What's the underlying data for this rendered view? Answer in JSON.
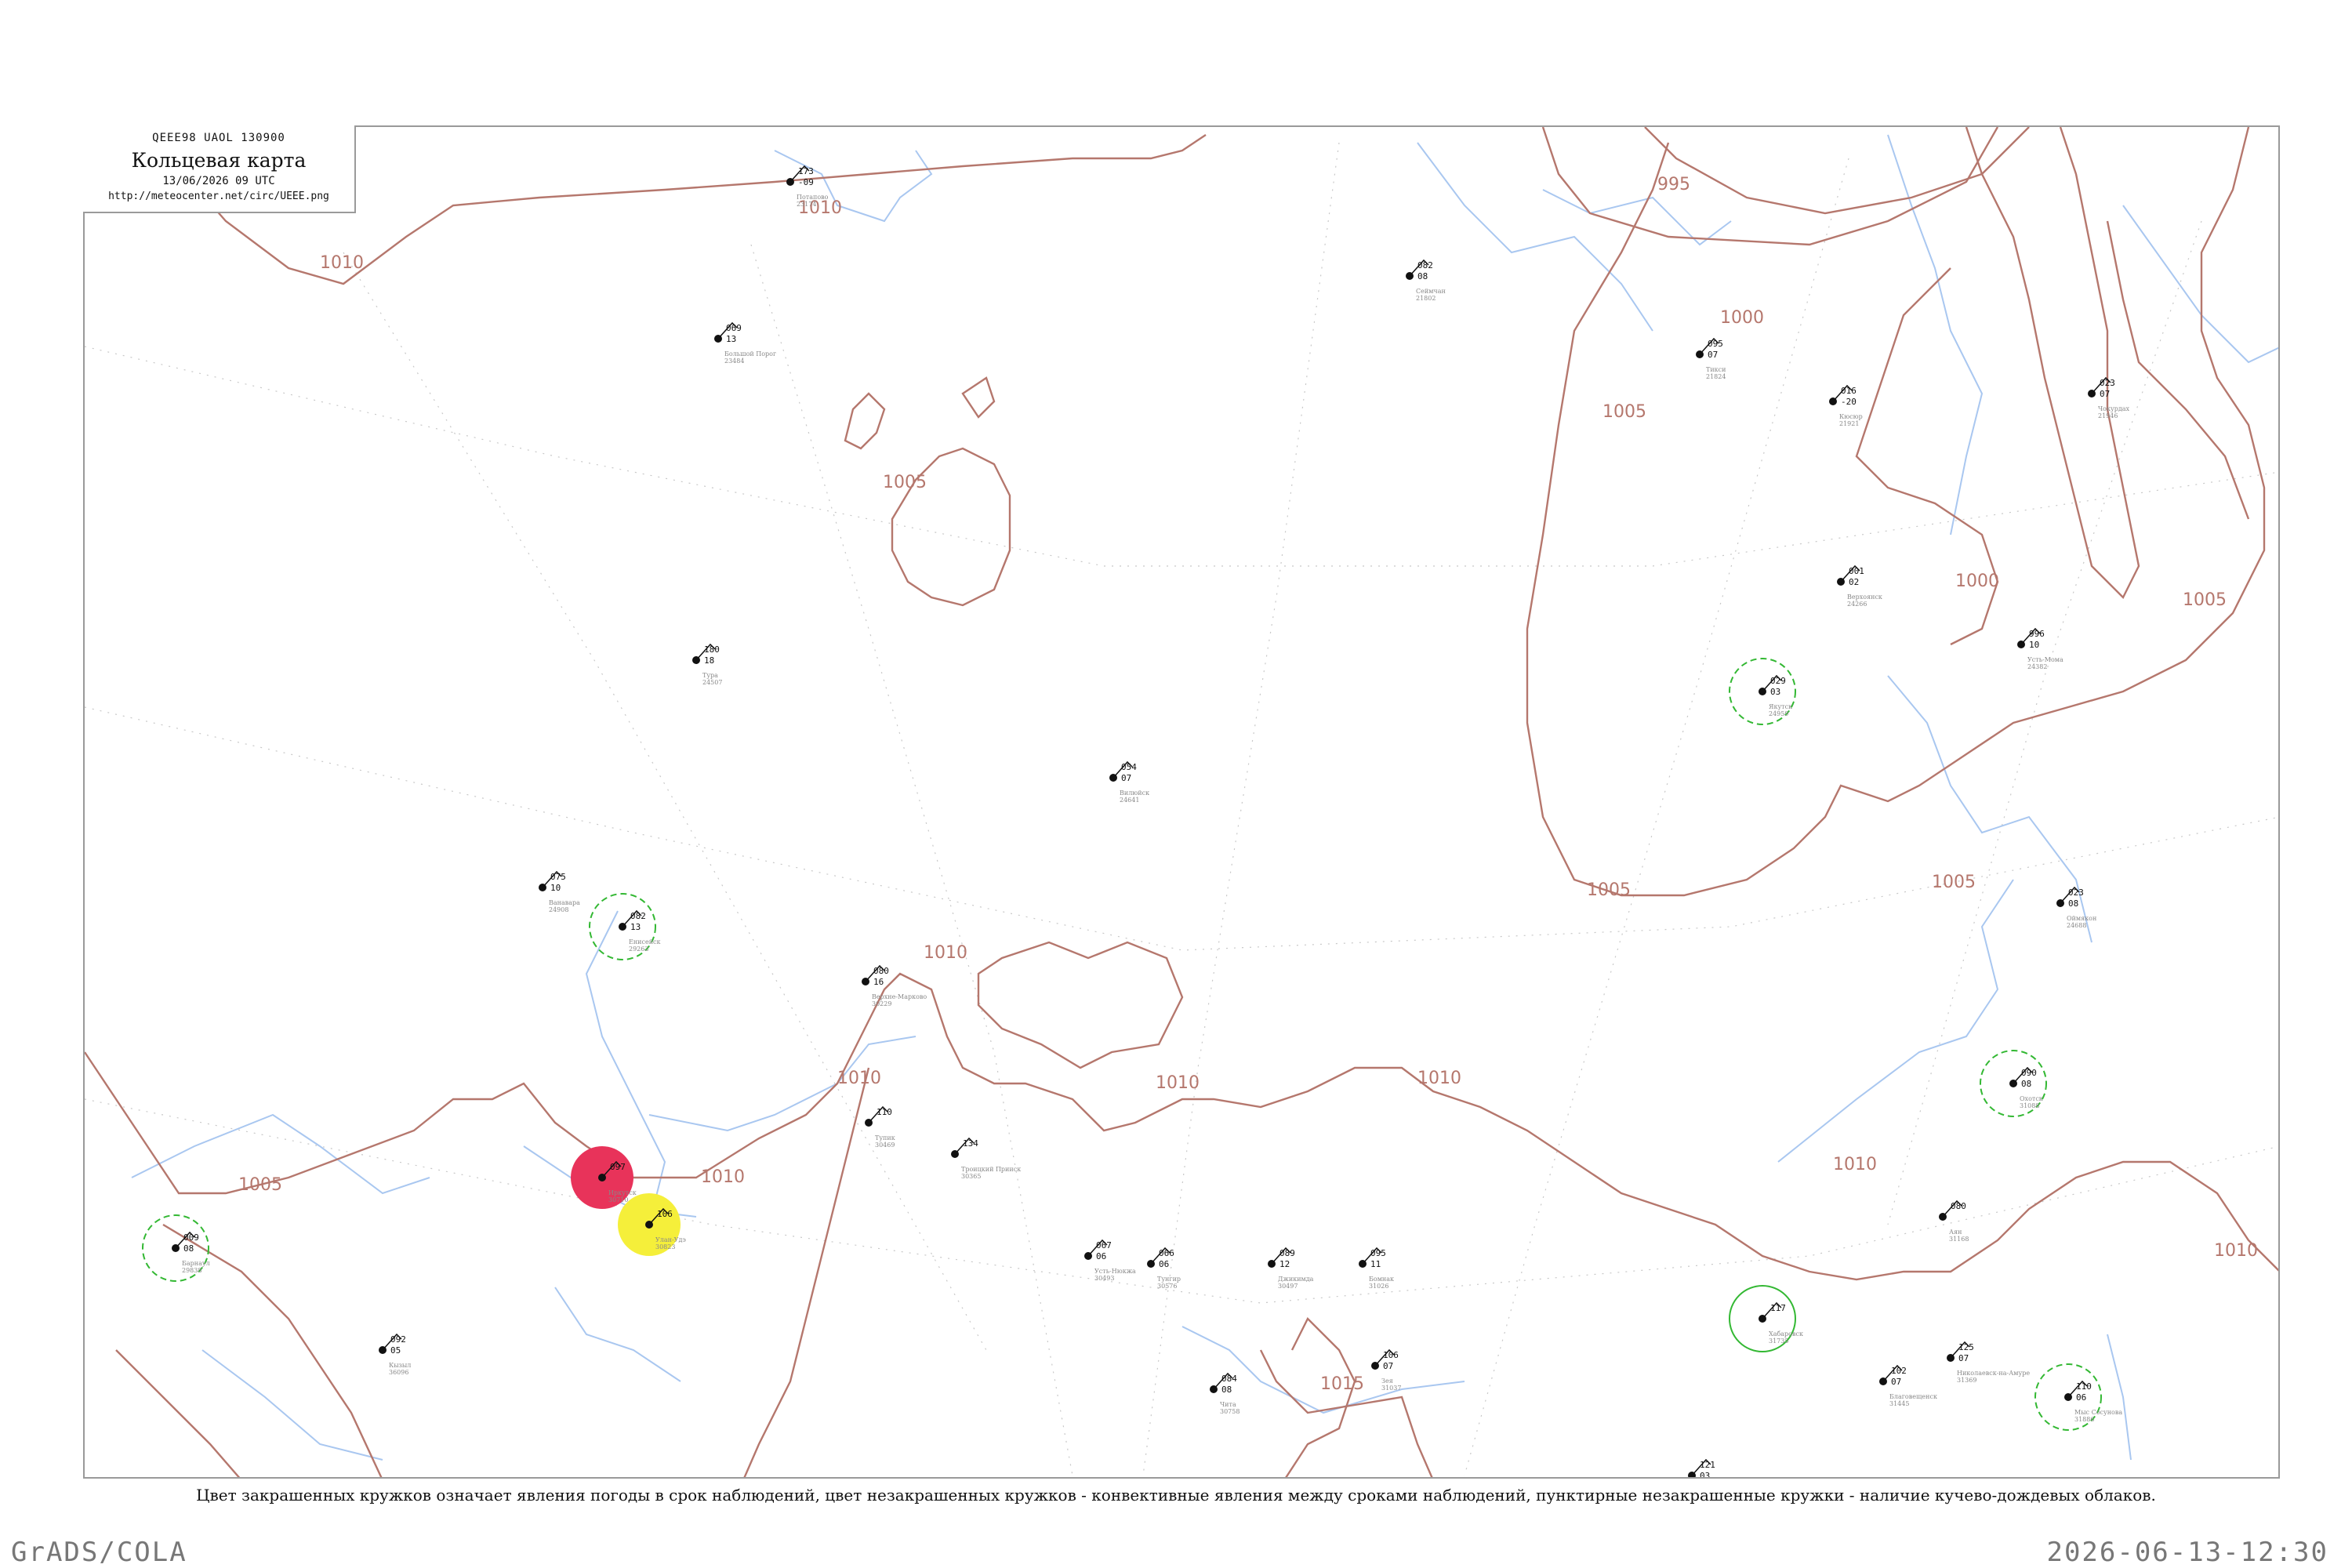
{
  "header": {
    "code": "QEEE98 UAOL 130900",
    "title": "Кольцевая карта",
    "datetime": "13/06/2026 09 UTC",
    "url": "http://meteocenter.net/circ/UEEE.png"
  },
  "caption": "Цвет закрашенных кружков означает явления погоды в срок наблюдений, цвет незакрашенных кружков - конвективные явления между сроками наблюдений, пунктирные незакрашенные кружки - наличие кучево-дождевых облаков.",
  "footer": {
    "left": "GrADS/COLA",
    "right": "2026-06-13-12:30"
  },
  "colors": {
    "isobar": "#b5776d",
    "coast": "#a9c7f0",
    "frame": "#9a9a9a",
    "cb_dashed": "#33b833",
    "fill_red": "#e8335a",
    "fill_green": "#1fb83a",
    "fill_yellow": "#f5ef3a"
  },
  "isobar_labels": [
    "1010",
    "1010",
    "1005",
    "995",
    "1000",
    "1005",
    "1000",
    "1005",
    "1005",
    "1005",
    "1010",
    "1010",
    "1010",
    "1010",
    "1010",
    "1005",
    "1010",
    "1015",
    "1010"
  ],
  "stations": [
    {
      "name": "Потапово",
      "id": "23174",
      "p": "173",
      "t": "-09",
      "marker": "none"
    },
    {
      "name": "Большой Порог",
      "id": "23484",
      "p": "069",
      "t": "13",
      "marker": "none"
    },
    {
      "name": "Сеймчан",
      "id": "21802",
      "p": "082",
      "t": "08",
      "marker": "none"
    },
    {
      "name": "Тикси",
      "id": "21824",
      "p": "095",
      "t": "07",
      "marker": "none"
    },
    {
      "name": "Кюсюр",
      "id": "21921",
      "p": "016",
      "t": "-20",
      "marker": "none"
    },
    {
      "name": "Чокурдах",
      "id": "21946",
      "p": "023",
      "t": "07",
      "marker": "none"
    },
    {
      "name": "Верхоянск",
      "id": "24266",
      "p": "001",
      "t": "02",
      "marker": "none"
    },
    {
      "name": "Усть-Мома",
      "id": "24382",
      "p": "996",
      "t": "10",
      "marker": "none"
    },
    {
      "name": "Тура",
      "id": "24507",
      "p": "180",
      "t": "18",
      "marker": "none"
    },
    {
      "name": "Вилюйск",
      "id": "24641",
      "p": "054",
      "t": "07",
      "marker": "none"
    },
    {
      "name": "Ванавара",
      "id": "24908",
      "p": "075",
      "t": "10",
      "marker": "none"
    },
    {
      "name": "Енисейск",
      "id": "29263",
      "p": "082",
      "t": "13",
      "marker": "green-dashed"
    },
    {
      "name": "Верхне-Марково",
      "id": "30229",
      "p": "080",
      "t": "16",
      "marker": "none"
    },
    {
      "name": "Тупик",
      "id": "30469",
      "p": "110",
      "t": "",
      "marker": "none"
    },
    {
      "name": "Троицкий Прииск",
      "id": "30365",
      "p": "134",
      "t": "",
      "marker": "none"
    },
    {
      "name": "Усть-Нюкжа",
      "id": "30493",
      "p": "067",
      "t": "06",
      "marker": "none"
    },
    {
      "name": "Тунгир",
      "id": "30576",
      "p": "066",
      "t": "06",
      "marker": "none"
    },
    {
      "name": "Джикимда",
      "id": "30497",
      "p": "089",
      "t": "12",
      "marker": "none"
    },
    {
      "name": "Бомнак",
      "id": "31026",
      "p": "095",
      "t": "11",
      "marker": "none"
    },
    {
      "name": "Зея",
      "id": "31037",
      "p": "106",
      "t": "07",
      "marker": "none"
    },
    {
      "name": "Благовещенск",
      "id": "31445",
      "p": "102",
      "t": "07",
      "marker": "none"
    },
    {
      "name": "Чита",
      "id": "30758",
      "p": "084",
      "t": "08",
      "marker": "none"
    },
    {
      "name": "Магдагачи",
      "id": "31299",
      "p": "121",
      "t": "03",
      "marker": "none"
    },
    {
      "name": "Охотск",
      "id": "31088",
      "p": "090",
      "t": "08",
      "marker": "green-dashed"
    },
    {
      "name": "Аян",
      "id": "31168",
      "p": "080",
      "t": "",
      "marker": "none"
    },
    {
      "name": "Николаевск-на-Амуре",
      "id": "31369",
      "p": "125",
      "t": "07",
      "marker": "none"
    },
    {
      "name": "Хабаровск",
      "id": "31735",
      "p": "117",
      "t": "",
      "marker": "green-double"
    },
    {
      "name": "Мыс Сосунова",
      "id": "31886",
      "p": "110",
      "t": "06",
      "marker": "green-dashed"
    },
    {
      "name": "Оймякон",
      "id": "24688",
      "p": "023",
      "t": "08",
      "marker": "none"
    },
    {
      "name": "Якутск",
      "id": "24959",
      "p": "029",
      "t": "03",
      "marker": "green-dashed"
    },
    {
      "name": "Иркутск",
      "id": "30710",
      "p": "097",
      "t": "",
      "marker": "red-fill"
    },
    {
      "name": "Улан-Удэ",
      "id": "30823",
      "p": "106",
      "t": "",
      "marker": "yellow-fill"
    },
    {
      "name": "Кызыл",
      "id": "36096",
      "p": "092",
      "t": "05",
      "marker": "none"
    },
    {
      "name": "Барнаул",
      "id": "29838",
      "p": "009",
      "t": "08",
      "marker": "green-dashed"
    }
  ]
}
